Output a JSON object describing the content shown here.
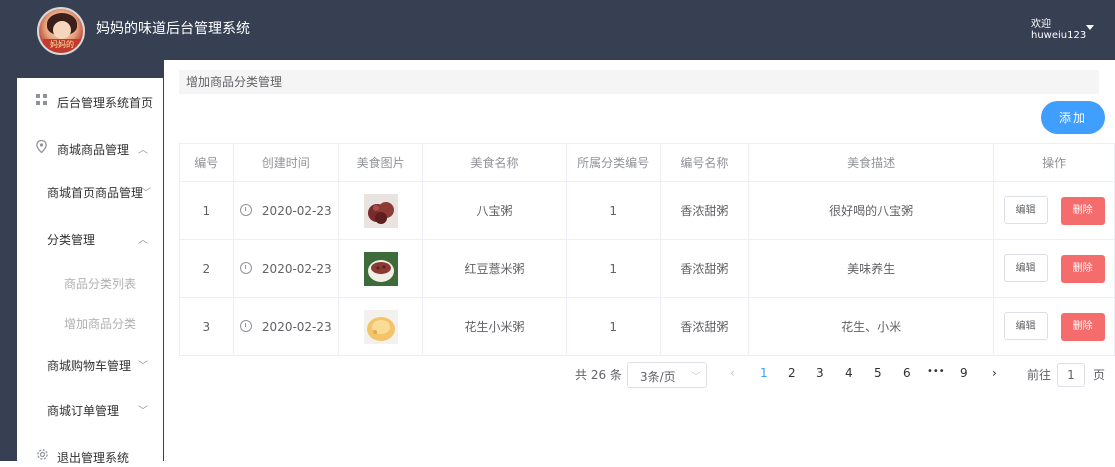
{
  "header": {
    "logo_text": "妈妈的",
    "app_title": "妈妈的味道后台管理系统",
    "welcome": "欢迎",
    "username": "huweiu123"
  },
  "sidebar": {
    "items": [
      {
        "label": "后台管理系统首页",
        "icon": "grid-icon"
      },
      {
        "label": "商城商品管理",
        "icon": "location-icon"
      },
      {
        "label": "商城首页商品管理"
      },
      {
        "label": "分类管理"
      },
      {
        "label": "商品分类列表"
      },
      {
        "label": "增加商品分类"
      },
      {
        "label": "商城购物车管理"
      },
      {
        "label": "商城订单管理"
      },
      {
        "label": "退出管理系统",
        "icon": "gear-icon"
      }
    ]
  },
  "main": {
    "breadcrumb": "增加商品分类管理",
    "add_button": "添加",
    "table": {
      "headers": [
        "编号",
        "创建时间",
        "美食图片",
        "美食名称",
        "所属分类编号",
        "编号名称",
        "美食描述",
        "操作"
      ],
      "rows": [
        {
          "id": "1",
          "date": "2020-02-23",
          "name": "八宝粥",
          "cat_id": "1",
          "cat_name": "香浓甜粥",
          "desc": "很好喝的八宝粥"
        },
        {
          "id": "2",
          "date": "2020-02-23",
          "name": "红豆薏米粥",
          "cat_id": "1",
          "cat_name": "香浓甜粥",
          "desc": "美味养生"
        },
        {
          "id": "3",
          "date": "2020-02-23",
          "name": "花生小米粥",
          "cat_id": "1",
          "cat_name": "香浓甜粥",
          "desc": "花生、小米"
        }
      ],
      "edit_label": "编辑",
      "delete_label": "删除"
    },
    "pagination": {
      "total": "共 26 条",
      "page_size": "3条/页",
      "pages": [
        "1",
        "2",
        "3",
        "4",
        "5",
        "6",
        "•••",
        "9"
      ],
      "current": "1",
      "goto_label": "前往",
      "goto_value": "1",
      "page_suffix": "页"
    }
  },
  "colors": {
    "header_bg": "#373f53",
    "primary": "#409eff",
    "danger": "#f56c6c"
  }
}
